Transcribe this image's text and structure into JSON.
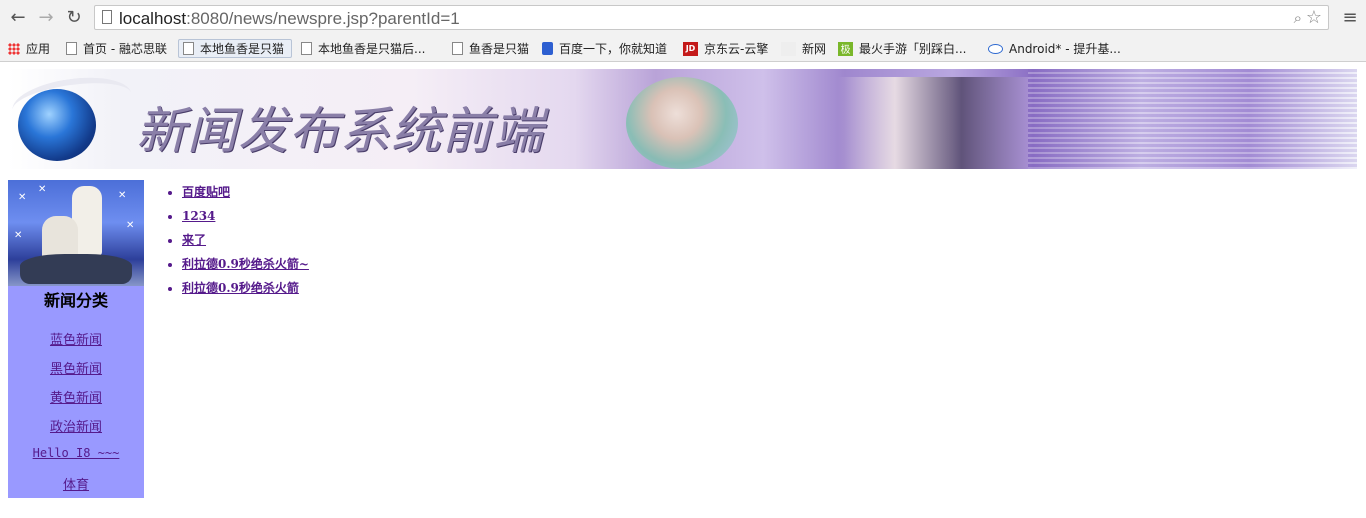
{
  "browser": {
    "url_host": "localhost",
    "url_rest": ":8080/news/newspre.jsp?parentId=1",
    "bookmarks": [
      {
        "label": "应用"
      },
      {
        "label": "首页 - 融芯思联"
      },
      {
        "label": "本地鱼香是只猫"
      },
      {
        "label": "本地鱼香是只猫后..."
      },
      {
        "label": "鱼香是只猫"
      },
      {
        "label": "百度一下，你就知道"
      },
      {
        "label": "京东云-云擎"
      },
      {
        "label": "新网"
      },
      {
        "label": "最火手游「别踩白..."
      },
      {
        "label": "Android* - 提升基..."
      }
    ]
  },
  "banner": {
    "title": "新闻发布系统前端"
  },
  "sidebar": {
    "title": "新闻分类",
    "categories": [
      {
        "label": "蓝色新闻"
      },
      {
        "label": "黑色新闻"
      },
      {
        "label": "黄色新闻"
      },
      {
        "label": "政治新闻"
      },
      {
        "label": "Hello I8 ~~~"
      },
      {
        "label": "体育"
      }
    ]
  },
  "news": {
    "items": [
      {
        "title": "百度贴吧"
      },
      {
        "title": "1234"
      },
      {
        "title": "来了"
      },
      {
        "title": "利拉德0.9秒绝杀火箭~"
      },
      {
        "title": "利拉德0.9秒绝杀火箭"
      }
    ]
  }
}
